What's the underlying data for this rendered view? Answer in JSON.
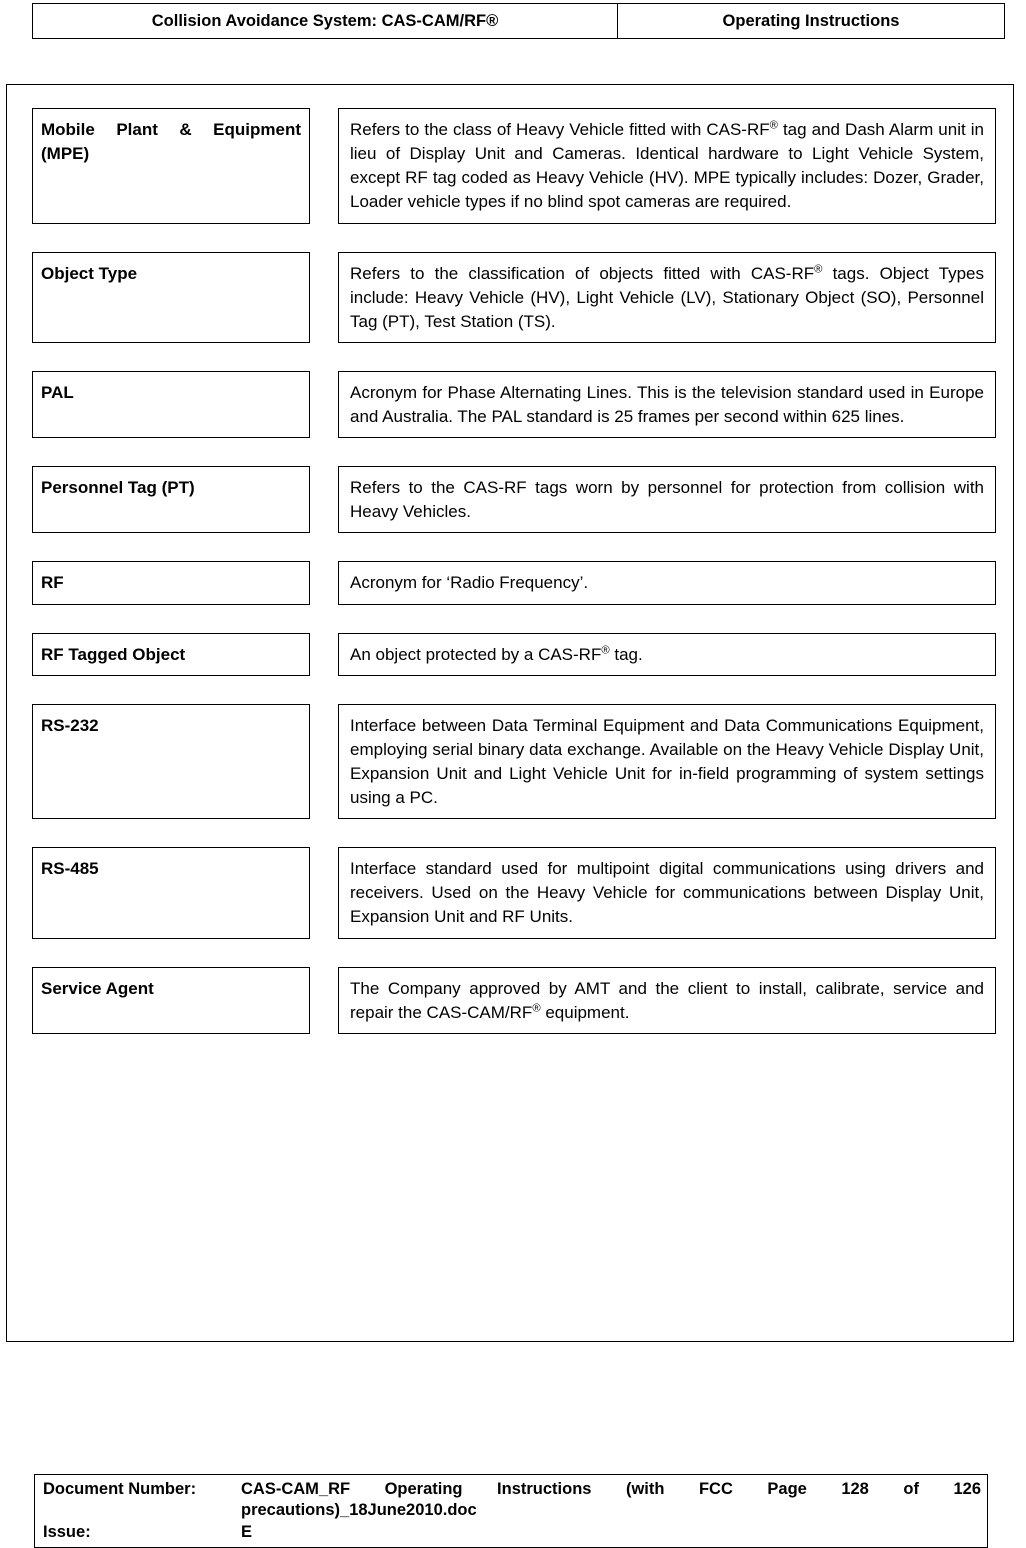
{
  "header": {
    "left_title": "Collision Avoidance System: CAS-CAM/RF®",
    "right_title": "Operating Instructions"
  },
  "glossary": {
    "rows": [
      {
        "term": "Mobile Plant & Equipment (MPE)",
        "term_justified": true,
        "description_parts": [
          "Refers to the class of Heavy Vehicle fitted with CAS-RF",
          "®",
          " tag and Dash Alarm unit in lieu of Display Unit and Cameras. Identical hardware to Light Vehicle System, except RF tag coded as Heavy Vehicle (HV).  MPE typically includes: Dozer, Grader, Loader vehicle types if no blind spot cameras are required."
        ]
      },
      {
        "term": "Object Type",
        "term_justified": false,
        "description_parts": [
          "Refers to the classification of objects fitted with CAS-RF",
          "®",
          " tags. Object Types include: Heavy Vehicle (HV), Light Vehicle (LV), Stationary Object (SO), Personnel Tag (PT), Test Station (TS)."
        ]
      },
      {
        "term": "PAL",
        "term_justified": false,
        "description_parts": [
          "Acronym for Phase Alternating Lines. This is the television standard used in Europe and Australia. The PAL standard is 25 frames per second within 625 lines.",
          "",
          ""
        ]
      },
      {
        "term": "Personnel Tag (PT)",
        "term_justified": false,
        "description_parts": [
          "Refers to the CAS-RF tags worn by personnel for protection from collision with Heavy Vehicles.",
          "",
          ""
        ]
      },
      {
        "term": "RF",
        "term_justified": false,
        "description_parts": [
          "Acronym for ‘Radio Frequency’.",
          "",
          ""
        ]
      },
      {
        "term": "RF Tagged Object",
        "term_justified": false,
        "description_parts": [
          "An object protected by a CAS-RF",
          "®",
          " tag."
        ]
      },
      {
        "term": "RS-232",
        "term_justified": false,
        "description_parts": [
          "Interface between Data Terminal Equipment and Data Communications Equipment, employing serial binary data exchange. Available on the Heavy Vehicle Display Unit, Expansion Unit and Light Vehicle Unit for in-field programming of system settings using a PC.",
          "",
          ""
        ]
      },
      {
        "term": "RS-485",
        "term_justified": false,
        "description_parts": [
          "Interface standard used for multipoint digital communications using drivers and receivers. Used on the Heavy Vehicle for communications between Display Unit, Expansion Unit and RF Units.",
          "",
          ""
        ]
      },
      {
        "term": "Service Agent",
        "term_justified": false,
        "description_parts": [
          "The Company approved by AMT and the client to install, calibrate, service and repair the CAS-CAM/RF",
          "®",
          " equipment."
        ]
      }
    ]
  },
  "footer": {
    "document_number_label": "Document Number:",
    "document_number_line1": "CAS-CAM_RF Operating Instructions (with FCC Page 128 of 126",
    "document_number_line2": "precautions)_18June2010.doc",
    "issue_label": "Issue:",
    "issue_value": "E"
  }
}
